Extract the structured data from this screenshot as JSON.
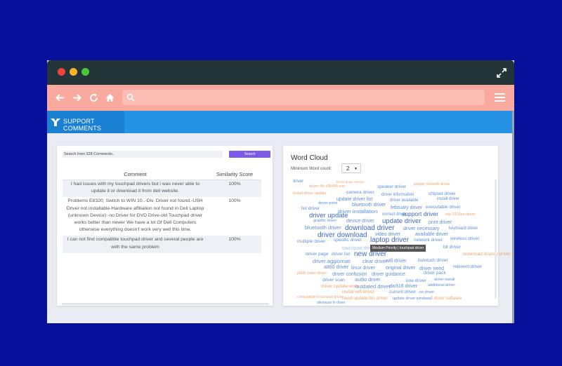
{
  "window": {
    "controls": [
      "close",
      "minimize",
      "maximize"
    ]
  },
  "toolbar": {
    "url": ""
  },
  "app": {
    "title": "SUPPORT COMMENTS"
  },
  "search": {
    "placeholder": "Search from 328 Comments..",
    "button": "Search"
  },
  "table": {
    "headers": [
      "Comment",
      "Similarity Score"
    ],
    "rows": [
      {
        "comment": "I had issues with my touchpad drivers but i was never able to update it or download it from dell website.",
        "score": "100%"
      },
      {
        "comment": "Problems E8320; Switch to WIN 10..-Div. Driver not found.-USH Driver not installable-Hardware affiliation not found in Dell Laptop (unknown Device) -no Driver for DVD Drive-old Touchpad driver works better than newer We have a lot Of Dell Computers otherwise everything doesn't work very well this time.",
        "score": "100%"
      },
      {
        "comment": "I can not find compatible touchpad driver and several people are with the same problem",
        "score": "100%"
      }
    ]
  },
  "wordcloud": {
    "title": "Word Cloud",
    "min_label": "Minimum Word count:",
    "min_value": "2",
    "tooltip": "Medium Priority | touchpad driver",
    "colors": {
      "blue": "#5b8fe0",
      "orange": "#f5a36b",
      "darkblue": "#3a68c7"
    },
    "words": [
      {
        "t": "bt-t03 driver version",
        "c": "orange"
      },
      {
        "t": "driver file r35445.exe",
        "c": "orange"
      },
      {
        "t": "speaker driver",
        "c": "blue"
      },
      {
        "t": "proper network driver",
        "c": "orange"
      },
      {
        "t": "install driver update",
        "c": "orange"
      },
      {
        "t": "camera driver",
        "c": "blue"
      },
      {
        "t": "driver information",
        "c": "blue"
      },
      {
        "t": "chipset driver",
        "c": "blue"
      },
      {
        "t": "update driver list",
        "c": "blue"
      },
      {
        "t": "driver available",
        "c": "blue"
      },
      {
        "t": "install driver",
        "c": "blue"
      },
      {
        "t": "driver point",
        "c": "blue"
      },
      {
        "t": "bluetooth driver",
        "c": "blue"
      },
      {
        "t": "february driver",
        "c": "blue"
      },
      {
        "t": "executable driver",
        "c": "blue"
      },
      {
        "t": "list driver",
        "c": "blue"
      },
      {
        "t": "driver installation",
        "c": "blue"
      },
      {
        "t": "correct driver",
        "c": "blue"
      },
      {
        "t": "support driver",
        "c": "darkblue"
      },
      {
        "t": "wip 3115cn driver",
        "c": "orange"
      },
      {
        "t": "driver update",
        "c": "darkblue"
      },
      {
        "t": "graphic driver",
        "c": "blue"
      },
      {
        "t": "device driver",
        "c": "blue"
      },
      {
        "t": "update driver",
        "c": "darkblue"
      },
      {
        "t": "print driver",
        "c": "blue"
      },
      {
        "t": "bluetooth driver",
        "c": "blue"
      },
      {
        "t": "download driver",
        "c": "darkblue"
      },
      {
        "t": "driver necessary",
        "c": "blue"
      },
      {
        "t": "keyboard driver",
        "c": "blue"
      },
      {
        "t": "driver download",
        "c": "darkblue"
      },
      {
        "t": "video driver",
        "c": "blue"
      },
      {
        "t": "available driver",
        "c": "blue"
      },
      {
        "t": "multiple driver",
        "c": "blue"
      },
      {
        "t": "specific driver",
        "c": "blue"
      },
      {
        "t": "laptop driver",
        "c": "darkblue"
      },
      {
        "t": "network driver",
        "c": "blue"
      },
      {
        "t": "wireless driver",
        "c": "blue"
      },
      {
        "t": "touchpad driver",
        "c": "blue"
      },
      {
        "t": "bit driver",
        "c": "blue"
      },
      {
        "t": "driver page",
        "c": "blue"
      },
      {
        "t": "driver list",
        "c": "blue"
      },
      {
        "t": "new driver",
        "c": "darkblue"
      },
      {
        "t": "driver aggiornati",
        "c": "blue"
      },
      {
        "t": "clear driver",
        "c": "blue"
      },
      {
        "t": "wifi driver",
        "c": "blue"
      },
      {
        "t": "bulutuch driver",
        "c": "blue"
      },
      {
        "t": "a860 driver",
        "c": "blue"
      },
      {
        "t": "linux driver",
        "c": "blue"
      },
      {
        "t": "original driver",
        "c": "blue"
      },
      {
        "t": "driver need",
        "c": "blue"
      },
      {
        "t": "relevent driver",
        "c": "blue"
      },
      {
        "t": "p600 video driver",
        "c": "orange"
      },
      {
        "t": "driver confusion",
        "c": "blue"
      },
      {
        "t": "driver guidance",
        "c": "blue"
      },
      {
        "t": "driver pack",
        "c": "blue"
      },
      {
        "t": "driver scan",
        "c": "blue"
      },
      {
        "t": "audio driver",
        "c": "blue"
      },
      {
        "t": "one driver",
        "c": "blue"
      },
      {
        "t": "driver install",
        "c": "blue"
      },
      {
        "t": "driver update work",
        "c": "orange"
      },
      {
        "t": "outdated driver",
        "c": "blue"
      },
      {
        "t": "dw316 driver",
        "c": "blue"
      },
      {
        "t": "additional driver",
        "c": "blue"
      },
      {
        "t": "install wifi driver",
        "c": "orange"
      },
      {
        "t": "current driver",
        "c": "blue"
      },
      {
        "t": "-no driver",
        "c": "blue"
      },
      {
        "t": "compatible touchpad driver",
        "c": "orange"
      },
      {
        "t": "need update bio driver",
        "c": "orange"
      },
      {
        "t": "update driver windows",
        "c": "blue"
      },
      {
        "t": "0 driver software",
        "c": "orange"
      },
      {
        "t": "alienware fx driver",
        "c": "blue"
      },
      {
        "t": "download display driver",
        "c": "orange"
      },
      {
        "t": "driver",
        "c": "blue"
      }
    ]
  }
}
